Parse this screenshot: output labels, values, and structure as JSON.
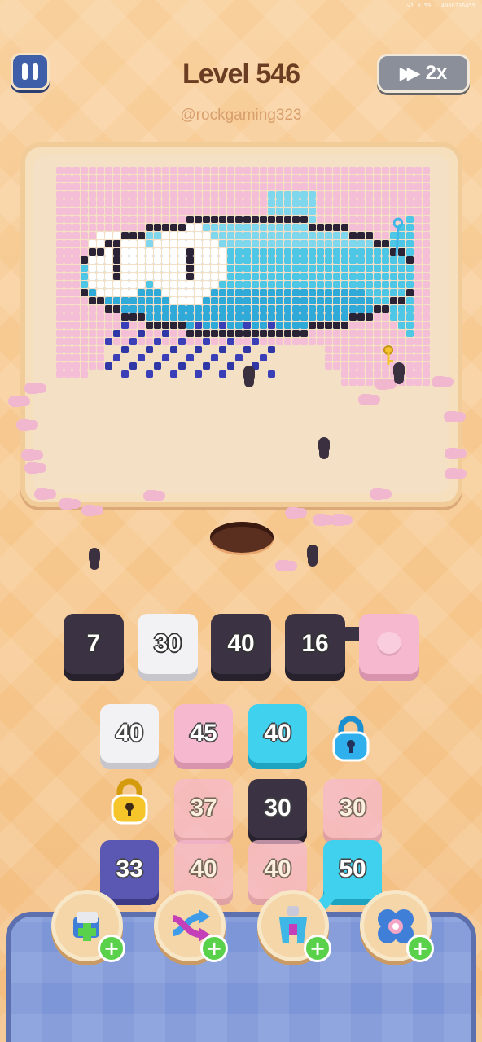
{
  "version_text": "v1.0.59 - 4908736455",
  "header": {
    "title": "Level 546",
    "watermark": "@rockgaming323",
    "speed_label": "2x"
  },
  "icons": {
    "pause": "pause-icon",
    "speed": "fast-forward-icon",
    "lock": "padlock-icon",
    "key": "key-icon"
  },
  "queue_slots": [
    {
      "value": "7",
      "color": "dark"
    },
    {
      "value": "30",
      "color": "white"
    },
    {
      "value": "40",
      "color": "dark"
    },
    {
      "value": "16",
      "color": "dark"
    },
    {
      "value": "",
      "color": "pink"
    }
  ],
  "tiles": [
    {
      "value": "40",
      "color": "white"
    },
    {
      "value": "45",
      "color": "pink"
    },
    {
      "value": "40",
      "color": "cyan"
    },
    {
      "value": "",
      "color": "lock-cyan"
    },
    {
      "value": "",
      "color": "lock-yellow"
    },
    {
      "value": "37",
      "color": "pink"
    },
    {
      "value": "30",
      "color": "dark"
    },
    {
      "value": "30",
      "color": "pink"
    },
    {
      "value": "33",
      "color": "purple"
    },
    {
      "value": "40",
      "color": "pink"
    },
    {
      "value": "40",
      "color": "pink"
    },
    {
      "value": "50",
      "color": "cyan"
    }
  ],
  "boosters": [
    {
      "name": "add-slot-booster",
      "icon": "add-box-icon"
    },
    {
      "name": "shuffle-booster",
      "icon": "shuffle-arrows-icon"
    },
    {
      "name": "magnet-booster",
      "icon": "magnet-claw-icon"
    },
    {
      "name": "target-booster",
      "icon": "flower-target-icon"
    }
  ],
  "colors": {
    "dark": "#3b3344",
    "white": "#f2f2f4",
    "pink": "#f6b8cf",
    "cyan": "#3fd1ee",
    "purple": "#5b58b3",
    "title": "#6b3d22"
  }
}
